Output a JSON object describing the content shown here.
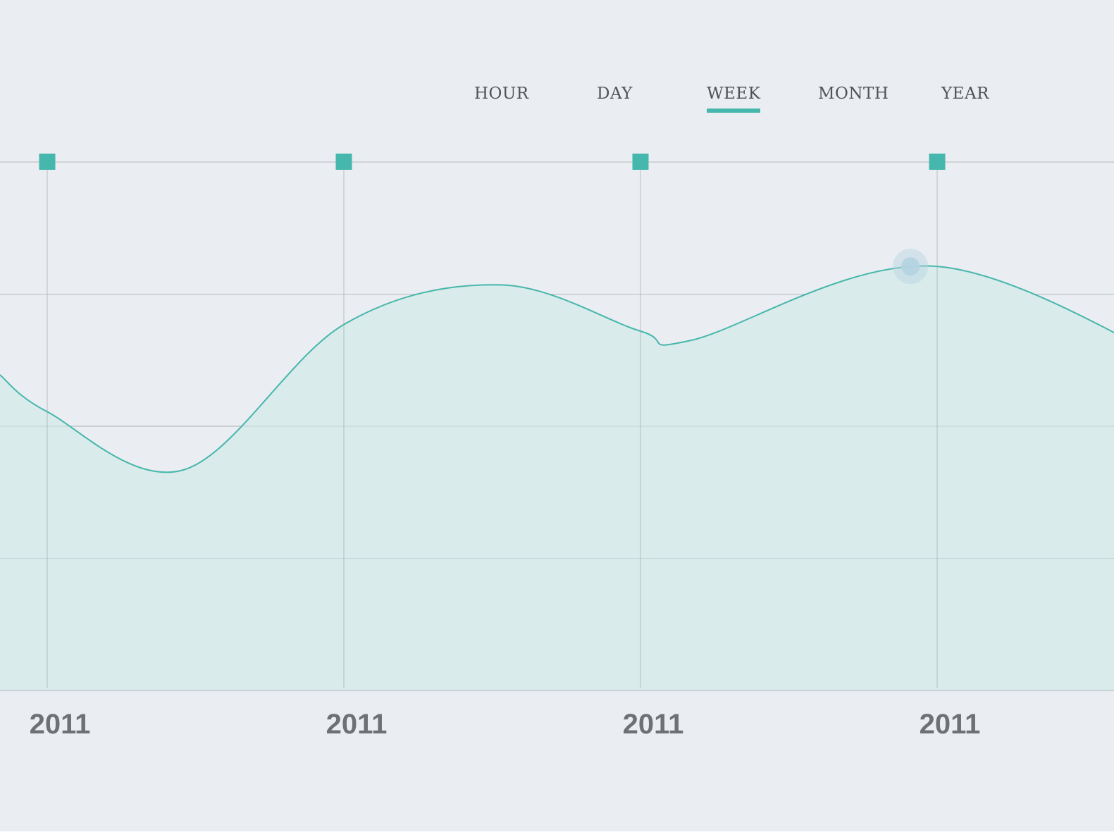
{
  "tabs": [
    {
      "label": "HOUR"
    },
    {
      "label": "DAY"
    },
    {
      "label": "WEEK",
      "active": true
    },
    {
      "label": "MONTH"
    },
    {
      "label": "YEAR"
    }
  ],
  "colors": {
    "accent": "#46b7ac",
    "area_fill": "#d9ebea",
    "grid": "#9aa0a8",
    "highlight": "#b5d3e2"
  },
  "chart_data": {
    "type": "area",
    "x_tick_labels": [
      "2011",
      "2011",
      "2011",
      "2011"
    ],
    "series": [
      {
        "values": [
          {
            "x": -0.16,
            "y": 2.39
          },
          {
            "x": 0.0,
            "y": 2.11
          },
          {
            "x": 0.46,
            "y": 1.67
          },
          {
            "x": 1.0,
            "y": 2.77
          },
          {
            "x": 1.53,
            "y": 3.07
          },
          {
            "x": 2.0,
            "y": 2.72
          },
          {
            "x": 2.17,
            "y": 2.65
          },
          {
            "x": 3.0,
            "y": 3.21
          },
          {
            "x": 3.91,
            "y": 2.34
          }
        ]
      }
    ],
    "highlight_point": {
      "x": 2.91,
      "y": 3.21
    },
    "ylim": [
      0,
      4
    ],
    "grid": true,
    "legend": false
  }
}
